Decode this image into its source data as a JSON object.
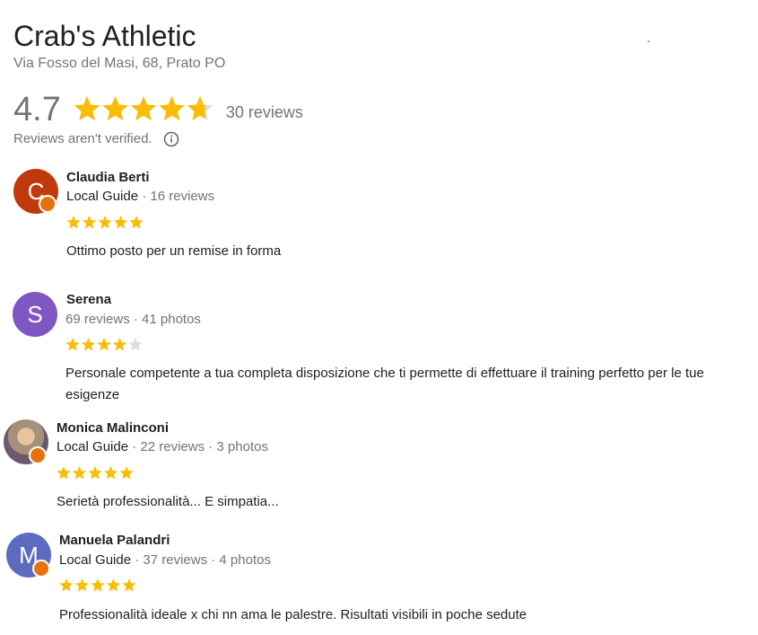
{
  "place": {
    "name": "Crab's Athletic",
    "address": "Via Fosso del Masi, 68, Prato PO",
    "rating": "4.7",
    "rating_value": 4.7,
    "review_count": "30 reviews",
    "verified_note": "Reviews aren't verified."
  },
  "colors": {
    "star": "#fbbc04",
    "star_empty": "#dadce0",
    "guide_badge": "#e8710a"
  },
  "icons": {
    "info": "info-icon",
    "guide": "local-guide-badge-icon",
    "star": "star-icon"
  },
  "reviews": [
    {
      "name": "Claudia Berti",
      "initial": "C",
      "avatar_color": "#c0390b",
      "local_guide": "Local Guide",
      "stats": "· 16 reviews",
      "stars": 5,
      "text": "Ottimo posto per un remise in forma"
    },
    {
      "name": "Serena",
      "initial": "S",
      "avatar_color": "#7e57c2",
      "local_guide": "",
      "stats": "69 reviews · 41 photos",
      "stars": 4,
      "text": "Personale competente a tua completa disposizione che ti permette di effettuare il training perfetto per le tue esigenze"
    },
    {
      "name": "Monica Malinconi",
      "initial": "",
      "avatar_color": "#8a7a86",
      "local_guide": "Local Guide",
      "stats": "· 22 reviews · 3 photos",
      "stars": 5,
      "text": "Serietà professionalità... E simpatia..."
    },
    {
      "name": "Manuela Palandri",
      "initial": "M",
      "avatar_color": "#5c6bc0",
      "local_guide": "Local Guide",
      "stats": "· 37 reviews · 4 photos",
      "stars": 5,
      "text": "Professionalità  ideale x chi nn ama le palestre. Risultati visibili in poche sedute"
    }
  ]
}
